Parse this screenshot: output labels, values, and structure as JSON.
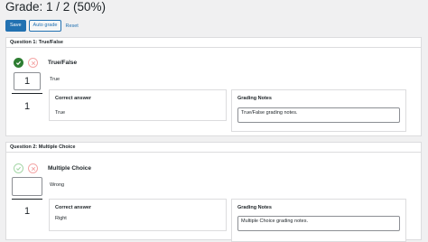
{
  "grade": {
    "title": "Grade: 1 / 2 (50%)"
  },
  "toolbar": {
    "save_label": "Save",
    "auto_grade_label": "Auto grade",
    "reset_label": "Reset"
  },
  "questions": [
    {
      "header": "Question 1: True/False",
      "title": "True/False",
      "answer": "True",
      "score": "1",
      "total": "1",
      "correct_answer_label": "Correct answer",
      "correct_answer": "True",
      "grading_notes_label": "Grading Notes",
      "grading_notes": "True/False grading notes.",
      "status": "correct"
    },
    {
      "header": "Question 2: Multiple Choice",
      "title": "Multiple Choice",
      "answer": "Wrong",
      "score": "",
      "total": "1",
      "correct_answer_label": "Correct answer",
      "correct_answer": "Right",
      "grading_notes_label": "Grading Notes",
      "grading_notes": "Multiple Choice grading notes.",
      "status": "ungraded"
    }
  ],
  "colors": {
    "correct": "#2e7d32",
    "correct_dim": "#a5d6a7",
    "incorrect": "#f4a7a7",
    "primary": "#2271b1"
  }
}
